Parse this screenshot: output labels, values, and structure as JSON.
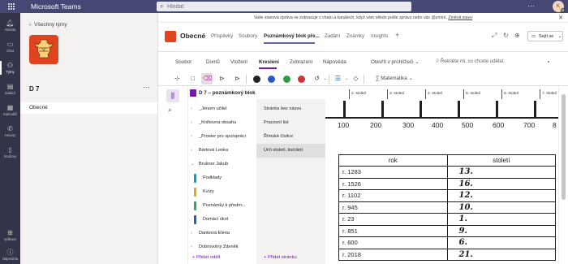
{
  "app": {
    "title": "Microsoft Teams",
    "avatar_initials": "K",
    "more": "···"
  },
  "search": {
    "placeholder": "Hledat",
    "value": ""
  },
  "rail": [
    {
      "label": "Aktivita",
      "icon": "bell-icon"
    },
    {
      "label": "Chat",
      "icon": "chat-icon"
    },
    {
      "label": "Týmy",
      "icon": "teams-icon",
      "active": true
    },
    {
      "label": "Zadání",
      "icon": "assignments-icon"
    },
    {
      "label": "Kalendář",
      "icon": "calendar-icon"
    },
    {
      "label": "Hovory",
      "icon": "phone-icon"
    },
    {
      "label": "Soubory",
      "icon": "files-icon"
    },
    {
      "label": "Aplikace",
      "icon": "apps-icon"
    },
    {
      "label": "Nápověda",
      "icon": "help-icon"
    }
  ],
  "team": {
    "back_label": "Všechny týmy",
    "name": "D 7",
    "more": "···",
    "channel": "Obecné"
  },
  "banner": {
    "text": "Vaše stavová zpráva se zobrazuje v chatu a kanálech, když vám někdo pošle zprávu nebo vás @zmíní.",
    "link": "Změnit stavu"
  },
  "channel": {
    "name": "Obecné",
    "tabs": [
      "Příspěvky",
      "Soubory",
      "Poznámkový blok pře...",
      "Zadání",
      "Známky",
      "Insights"
    ],
    "active_tab": 2,
    "share_label": "Sejít se"
  },
  "ribbon": {
    "tabs": [
      "Soubor",
      "Domů",
      "Vložení",
      "Kreslení",
      "Zobrazení",
      "Nápověda",
      "Otevřít v prohlížeči"
    ],
    "active_tab": 3,
    "tell_me": "Řekněte mi, co chcete udělat.",
    "math_label": "Matematika",
    "pen_colors": [
      "#252423",
      "#2b59c3",
      "#2e9e44",
      "#d13438"
    ]
  },
  "notebook": {
    "title": "D 7 – poznámkový blok",
    "sections": [
      {
        "label": "_Jenom učitel",
        "arrow": "›",
        "indent": 0
      },
      {
        "label": "_Knihovna obsahu",
        "arrow": "›",
        "indent": 0
      },
      {
        "label": "_Prostor pro spolupráci",
        "arrow": "›",
        "indent": 0
      },
      {
        "label": "Bártová Lenka",
        "arrow": "›",
        "indent": 0
      },
      {
        "label": "Brukner Jakub",
        "arrow": "⌄",
        "indent": 0
      },
      {
        "label": "Podklady",
        "color": "#00a1c4",
        "indent": 1
      },
      {
        "label": "Kvízy",
        "color": "#f0a30a",
        "indent": 1
      },
      {
        "label": "Poznámky k předm...",
        "color": "#3aa65c",
        "indent": 1
      },
      {
        "label": "Domácí úkol",
        "color": "#2b59c3",
        "indent": 1,
        "selected": true
      },
      {
        "label": "Danková Elena",
        "arrow": "›",
        "indent": 0
      },
      {
        "label": "Dobrovolný Zdeněk",
        "arrow": "›",
        "indent": 0
      }
    ],
    "add_section": "Přidat oddíl",
    "pages": [
      "Stránka bez názvu",
      "Pracovní list",
      "Římské číslice",
      "Urči století, tisíciletí"
    ],
    "selected_page": 3,
    "add_page": "Přidat stránku"
  },
  "worksheet": {
    "header_cells": [
      "2. století",
      "3. století",
      "4. století",
      "5. století",
      "6. století",
      "7. století"
    ],
    "axis_numbers": [
      "100",
      "200",
      "300",
      "400",
      "500",
      "600",
      "700",
      "8"
    ],
    "table_headers": [
      "rok",
      "století"
    ],
    "rows": [
      {
        "year": "r. 1283",
        "century": "13."
      },
      {
        "year": "r. 1526",
        "century": "16."
      },
      {
        "year": "r. 1102",
        "century": "12."
      },
      {
        "year": "r. 945",
        "century": "10."
      },
      {
        "year": "r. 23",
        "century": "1."
      },
      {
        "year": "r. 851",
        "century": "9."
      },
      {
        "year": "r. 600",
        "century": "6."
      },
      {
        "year": "r. 2018",
        "century": "21."
      }
    ]
  }
}
